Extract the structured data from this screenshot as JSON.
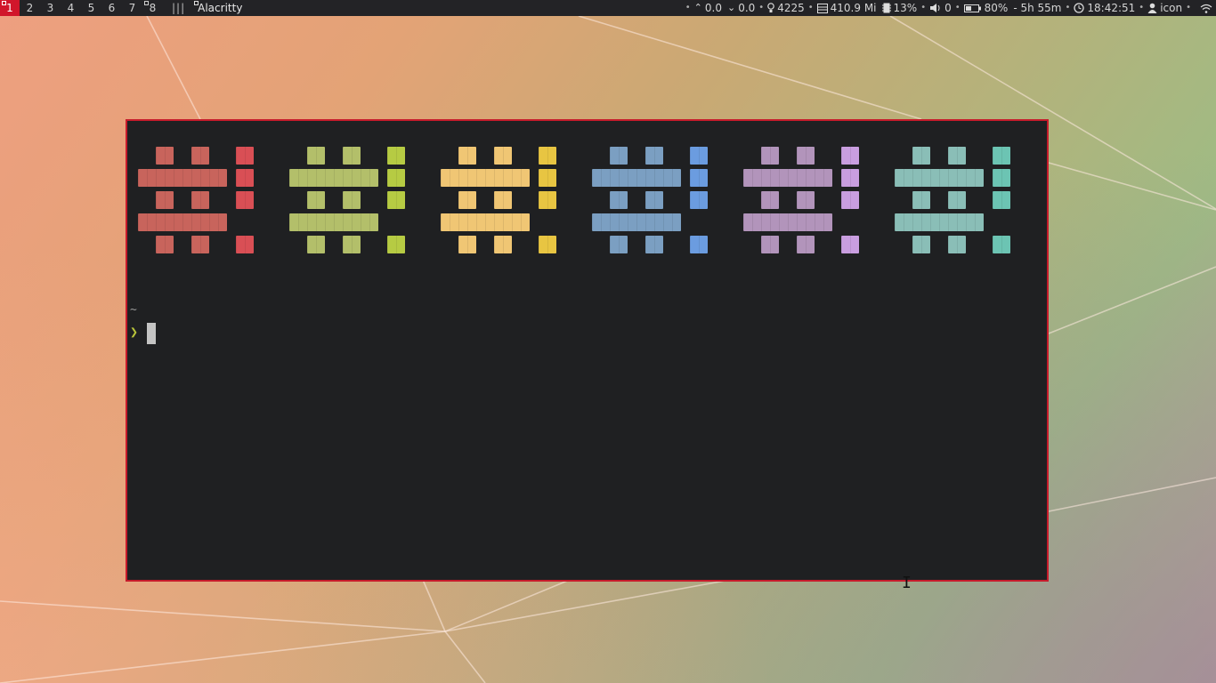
{
  "topbar": {
    "workspaces": [
      "1",
      "2",
      "3",
      "4",
      "5",
      "6",
      "7",
      "8"
    ],
    "active_workspace": "1",
    "layout_indicator": "|||",
    "window_title": "Alacritty",
    "status": {
      "net_up": "0.0",
      "net_down": "0.0",
      "brightness": "4225",
      "memory": "410.9 Mi",
      "cpu": "13%",
      "volume": "0",
      "battery": "80%",
      "battery_time": "- 5h 55m",
      "clock": "18:42:51",
      "user": "icon"
    }
  },
  "terminal": {
    "cwd": "~",
    "prompt_symbol": "❯",
    "border_color": "#c61b2b",
    "background": "#1f2022",
    "palette": [
      {
        "normal": "#c8645c",
        "bright": "#d94f55"
      },
      {
        "normal": "#b3bf6a",
        "bright": "#b6cb43"
      },
      {
        "normal": "#f0c674",
        "bright": "#e8c542"
      },
      {
        "normal": "#7b9fc2",
        "bright": "#6b9ce0"
      },
      {
        "normal": "#b294bb",
        "bright": "#c99ee0"
      },
      {
        "normal": "#8abeb7",
        "bright": "#6cc4b3"
      }
    ]
  },
  "icons": {
    "net_up": "chevron-up-icon",
    "net_down": "chevron-down-icon",
    "brightness": "lightbulb-icon",
    "memory": "memory-icon",
    "cpu": "cpu-icon",
    "volume": "speaker-icon",
    "battery": "battery-icon",
    "clock": "clock-icon",
    "user": "user-icon",
    "wifi": "wifi-icon"
  }
}
